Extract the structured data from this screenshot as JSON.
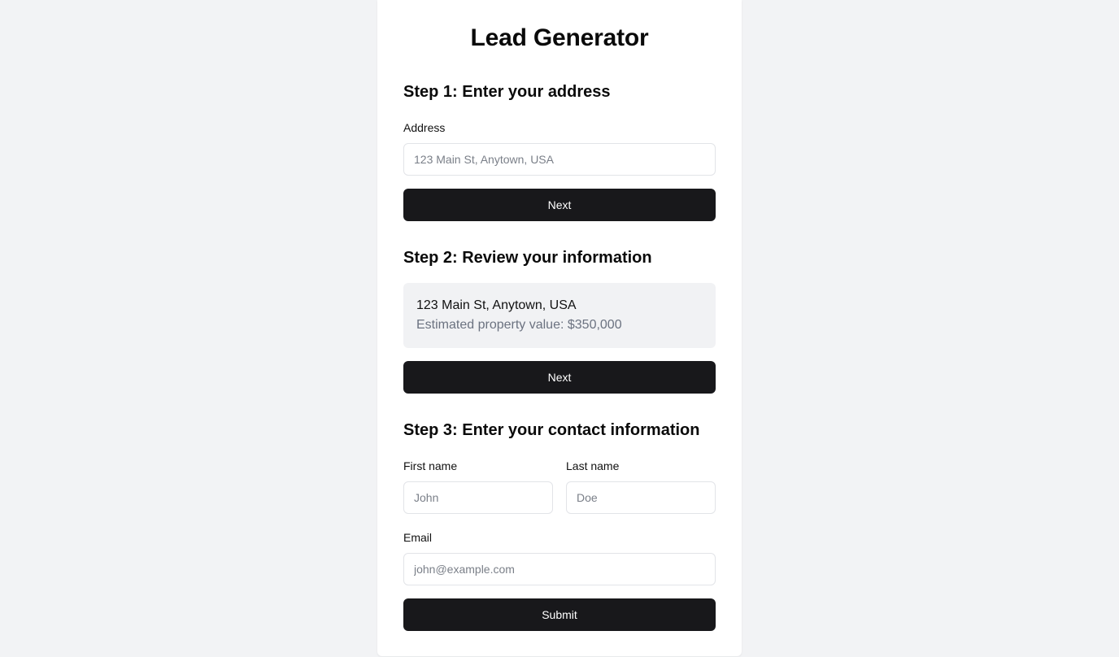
{
  "app": {
    "title": "Lead Generator"
  },
  "step1": {
    "heading": "Step 1: Enter your address",
    "address_label": "Address",
    "address_placeholder": "123 Main St, Anytown, USA",
    "next_label": "Next"
  },
  "step2": {
    "heading": "Step 2: Review your information",
    "address": "123 Main St, Anytown, USA",
    "estimate": "Estimated property value: $350,000",
    "next_label": "Next"
  },
  "step3": {
    "heading": "Step 3: Enter your contact information",
    "first_name_label": "First name",
    "first_name_placeholder": "John",
    "last_name_label": "Last name",
    "last_name_placeholder": "Doe",
    "email_label": "Email",
    "email_placeholder": "john@example.com",
    "submit_label": "Submit"
  },
  "colors": {
    "background": "#f2f3f5",
    "card": "#ffffff",
    "button": "#18181b",
    "review_box": "#f1f2f4",
    "muted_text": "#6b7280"
  }
}
